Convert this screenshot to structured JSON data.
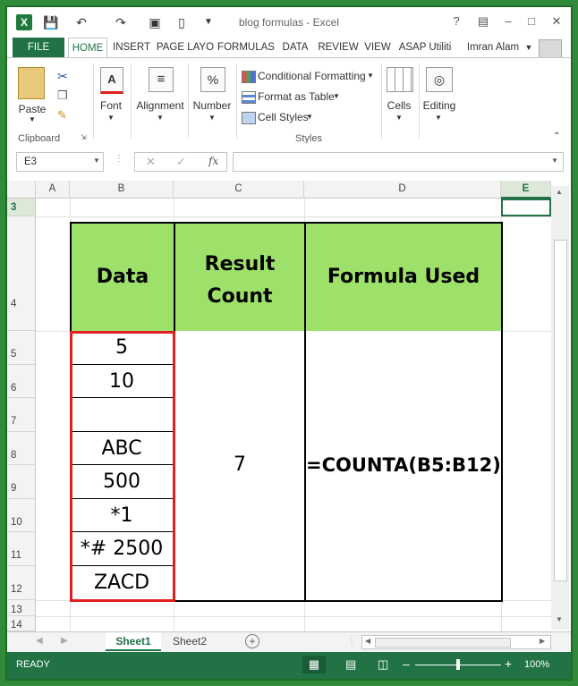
{
  "window": {
    "title": "blog formulas - Excel",
    "help": "?",
    "user": "Imran Alam"
  },
  "tabs": [
    "FILE",
    "HOME",
    "INSERT",
    "PAGE LAYO",
    "FORMULAS",
    "DATA",
    "REVIEW",
    "VIEW",
    "ASAP Utiliti"
  ],
  "ribbon": {
    "paste": "Paste",
    "clipboard": "Clipboard",
    "font": "Font",
    "alignment": "Alignment",
    "number": "Number",
    "number_glyph": "%",
    "font_glyph": "A",
    "conditional": "Conditional Formatting",
    "format_table": "Format as Table",
    "cell_styles": "Cell Styles",
    "styles": "Styles",
    "cells": "Cells",
    "editing": "Editing"
  },
  "formula_bar": {
    "name_box": "E3",
    "fx": "fx",
    "value": ""
  },
  "columns": [
    "A",
    "B",
    "C",
    "D",
    "E"
  ],
  "rows": [
    "3",
    "4",
    "5",
    "6",
    "7",
    "8",
    "9",
    "10",
    "11",
    "12",
    "13",
    "14"
  ],
  "table": {
    "headers": [
      "Data",
      "Result Count",
      "Formula Used"
    ],
    "data": [
      "5",
      "10",
      "",
      "ABC",
      "500",
      "*1",
      "*# 2500",
      "ZACD"
    ],
    "result": "7",
    "formula": "=COUNTA(B5:B12)"
  },
  "sheets": [
    "Sheet1",
    "Sheet2"
  ],
  "status": {
    "ready": "READY",
    "zoom": "100%"
  },
  "colors": {
    "header_fill": "#9de16a",
    "excel_green": "#217346",
    "highlight_border": "#e02020"
  }
}
